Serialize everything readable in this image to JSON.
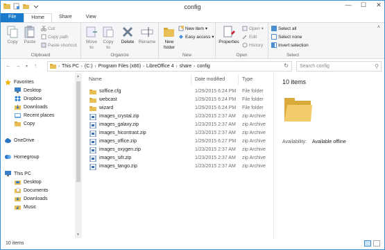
{
  "window": {
    "title": "config"
  },
  "tabs": {
    "file": "File",
    "home": "Home",
    "share": "Share",
    "view": "View"
  },
  "ribbon": {
    "clipboard": {
      "label": "Clipboard",
      "copy": "Copy",
      "paste": "Paste",
      "cut": "Cut",
      "copy_path": "Copy path",
      "paste_shortcut": "Paste shortcut"
    },
    "organize": {
      "label": "Organize",
      "move_to": "Move\nto",
      "copy_to": "Copy\nto",
      "delete": "Delete",
      "rename": "Rename"
    },
    "new": {
      "label": "New",
      "new_folder": "New\nfolder",
      "new_item": "New item",
      "easy_access": "Easy access"
    },
    "open": {
      "label": "Open",
      "properties": "Properties",
      "open": "Open",
      "edit": "Edit",
      "history": "History"
    },
    "select": {
      "label": "Select",
      "select_all": "Select all",
      "select_none": "Select none",
      "invert": "Invert selection"
    }
  },
  "address": {
    "crumbs": [
      "This PC",
      "(C:)",
      "Program Files (x86)",
      "LibreOffice 4",
      "share",
      "config"
    ],
    "search_placeholder": "Search config"
  },
  "nav": {
    "favorites": "Favorites",
    "desktop": "Desktop",
    "dropbox": "Dropbox",
    "downloads": "Downloads",
    "recent": "Recent places",
    "copy": "Copy",
    "onedrive": "OneDrive",
    "homegroup": "Homegroup",
    "thispc": "This PC",
    "pc_desktop": "Desktop",
    "pc_documents": "Documents",
    "pc_downloads": "Downloads",
    "pc_music": "Music"
  },
  "columns": {
    "name": "Name",
    "date": "Date modified",
    "type": "Type"
  },
  "files": [
    {
      "name": "soffice.cfg",
      "date": "1/29/2015 6:24 PM",
      "type": "File folder"
    },
    {
      "name": "webcast",
      "date": "1/29/2015 6:24 PM",
      "type": "File folder"
    },
    {
      "name": "wizard",
      "date": "1/29/2015 6:24 PM",
      "type": "File folder"
    },
    {
      "name": "images_crystal.zip",
      "date": "1/23/2015 2:37 AM",
      "type": "zip Archive"
    },
    {
      "name": "images_galaxy.zip",
      "date": "1/23/2015 2:37 AM",
      "type": "zip Archive"
    },
    {
      "name": "images_hicontrast.zip",
      "date": "1/23/2015 2:37 AM",
      "type": "zip Archive"
    },
    {
      "name": "images_office.zip",
      "date": "1/29/2015 6:27 PM",
      "type": "zip Archive"
    },
    {
      "name": "images_oxygen.zip",
      "date": "1/23/2015 2:37 AM",
      "type": "zip Archive"
    },
    {
      "name": "images_sifr.zip",
      "date": "1/23/2015 2:37 AM",
      "type": "zip Archive"
    },
    {
      "name": "images_tango.zip",
      "date": "1/23/2015 2:37 AM",
      "type": "zip Archive"
    }
  ],
  "details": {
    "count": "10 items",
    "availability_label": "Availability:",
    "availability_value": "Available offline"
  },
  "status": {
    "count": "10 items"
  },
  "colors": {
    "accent": "#1979ca",
    "folder": "#e8bf55"
  }
}
